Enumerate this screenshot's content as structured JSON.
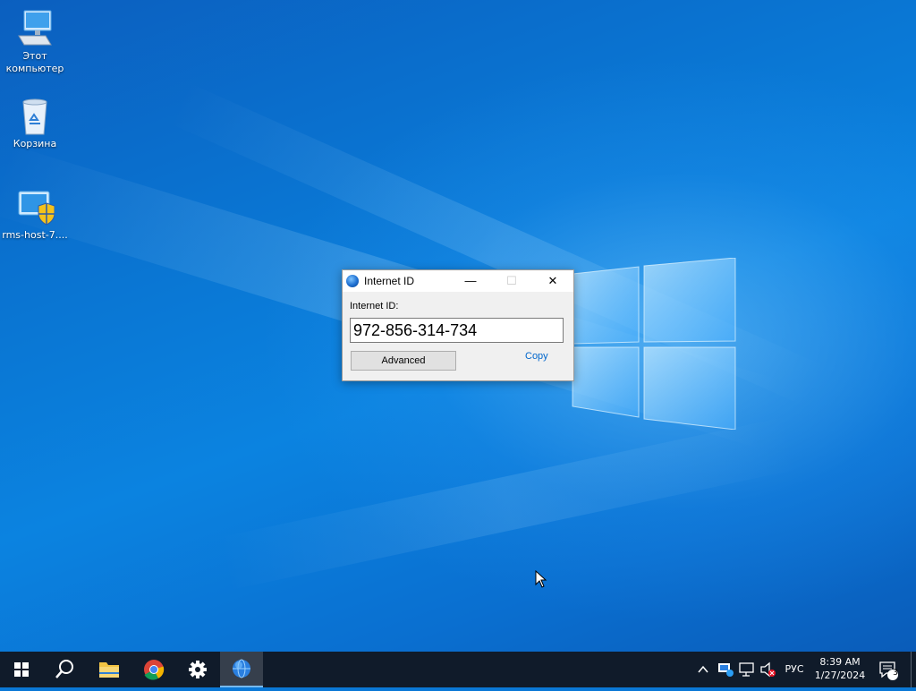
{
  "desktop": {
    "icons": [
      {
        "label": "Этот компьютер",
        "icon": "this-pc-icon"
      },
      {
        "label": "Корзина",
        "icon": "recycle-bin-icon"
      },
      {
        "label": "rms-host-7....",
        "icon": "installer-shield-icon"
      }
    ]
  },
  "dialog": {
    "title": "Internet ID",
    "id_label": "Internet ID:",
    "id_value": "972-856-314-734",
    "advanced_label": "Advanced",
    "copy_label": "Copy",
    "minimize_glyph": "—",
    "maximize_glyph": "☐",
    "close_glyph": "✕"
  },
  "taskbar": {
    "items": [
      {
        "name": "start-button",
        "icon": "windows-start-icon"
      },
      {
        "name": "search-button",
        "icon": "search-icon"
      },
      {
        "name": "file-explorer",
        "icon": "folder-icon"
      },
      {
        "name": "chrome",
        "icon": "chrome-icon"
      },
      {
        "name": "settings",
        "icon": "gear-icon"
      },
      {
        "name": "internet-id-app",
        "icon": "globe-icon"
      }
    ],
    "tray": {
      "language": "РУС",
      "time": "8:39 AM",
      "date": "1/27/2024",
      "notification_count": "3"
    }
  },
  "colors": {
    "taskbar_bg": "#101b2a",
    "accent": "#76b9ed",
    "link": "#0066cc"
  }
}
